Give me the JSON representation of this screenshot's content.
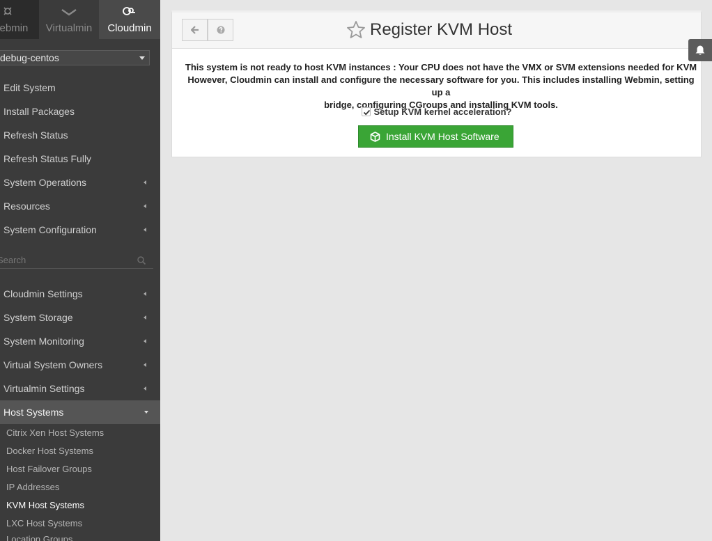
{
  "nav": {
    "tabs": [
      {
        "label": "Webmin",
        "icon": "webmin-icon",
        "active": false
      },
      {
        "label": "Virtualmin",
        "icon": "virtualmin-icon",
        "active": false
      },
      {
        "label": "Cloudmin",
        "icon": "cloudmin-icon",
        "active": true
      }
    ]
  },
  "sidebar": {
    "server": "debug-centos",
    "menu_top": [
      {
        "label": "Edit System",
        "has_arrow": false
      },
      {
        "label": "Install Packages",
        "has_arrow": false
      },
      {
        "label": "Refresh Status",
        "has_arrow": false
      },
      {
        "label": "Refresh Status Fully",
        "has_arrow": false
      },
      {
        "label": "System Operations",
        "has_arrow": true
      },
      {
        "label": "Resources",
        "has_arrow": true
      },
      {
        "label": "System Configuration",
        "has_arrow": true
      }
    ],
    "search_placeholder": "Search",
    "menu_bottom": [
      {
        "label": "Cloudmin Settings",
        "has_arrow": true
      },
      {
        "label": "System Storage",
        "has_arrow": true
      },
      {
        "label": "System Monitoring",
        "has_arrow": true
      },
      {
        "label": "Virtual System Owners",
        "has_arrow": true
      },
      {
        "label": "Virtualmin Settings",
        "has_arrow": true
      },
      {
        "label": "Host Systems",
        "has_arrow": true,
        "open": true
      }
    ],
    "host_systems_items": [
      {
        "label": "Citrix Xen Host Systems",
        "active": false
      },
      {
        "label": "Docker Host Systems",
        "active": false
      },
      {
        "label": "Host Failover Groups",
        "active": false
      },
      {
        "label": "IP Addresses",
        "active": false
      },
      {
        "label": "KVM Host Systems",
        "active": true
      },
      {
        "label": "LXC Host Systems",
        "active": false
      },
      {
        "label": "Location Groups",
        "active": false
      }
    ]
  },
  "page": {
    "title": "Register KVM Host",
    "message_lines": [
      "This system is not ready to host KVM instances : Your CPU does not have the VMX or SVM extensions needed for KVM",
      "However, Cloudmin can install and configure the necessary software for you. This includes installing Webmin, setting up a",
      "bridge, configuring CGroups and installing KVM tools."
    ],
    "checkbox_label": "Setup KVM kernel acceleration?",
    "checkbox_checked": true,
    "install_button": "Install KVM Host Software"
  },
  "colors": {
    "sidebar_bg": "#3b3b3b",
    "accent_green": "#3aa536",
    "content_bg": "#e6e6e6"
  }
}
